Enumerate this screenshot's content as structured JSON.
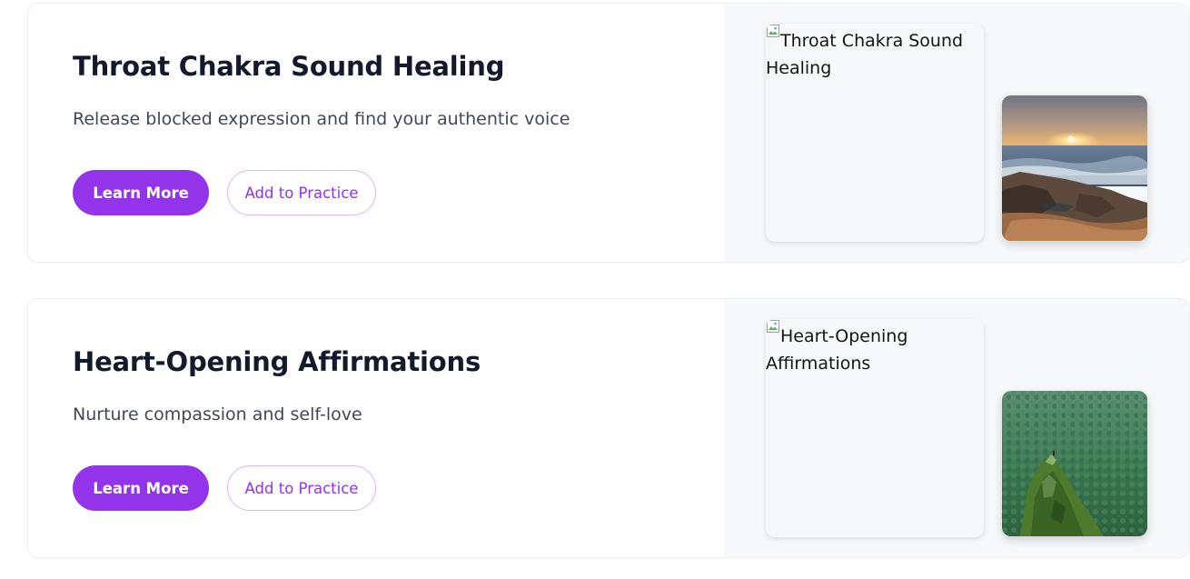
{
  "cards": [
    {
      "title": "Throat Chakra Sound Healing",
      "description": "Release blocked expression and find your authentic voice",
      "primary_button": "Learn More",
      "secondary_button": "Add to Practice",
      "image_alt": "Throat Chakra Sound Healing",
      "thumbnail": "sunset-over-rocky-seashore"
    },
    {
      "title": "Heart-Opening Affirmations",
      "description": "Nurture compassion and self-love",
      "primary_button": "Learn More",
      "secondary_button": "Add to Practice",
      "image_alt": "Heart-Opening Affirmations",
      "thumbnail": "green-forest-cliff"
    }
  ],
  "colors": {
    "accent": "#9333ea",
    "accent_border": "#d8b4fe",
    "title": "#141a2b",
    "body_text": "#404857",
    "media_panel": "#f7f8fa"
  }
}
